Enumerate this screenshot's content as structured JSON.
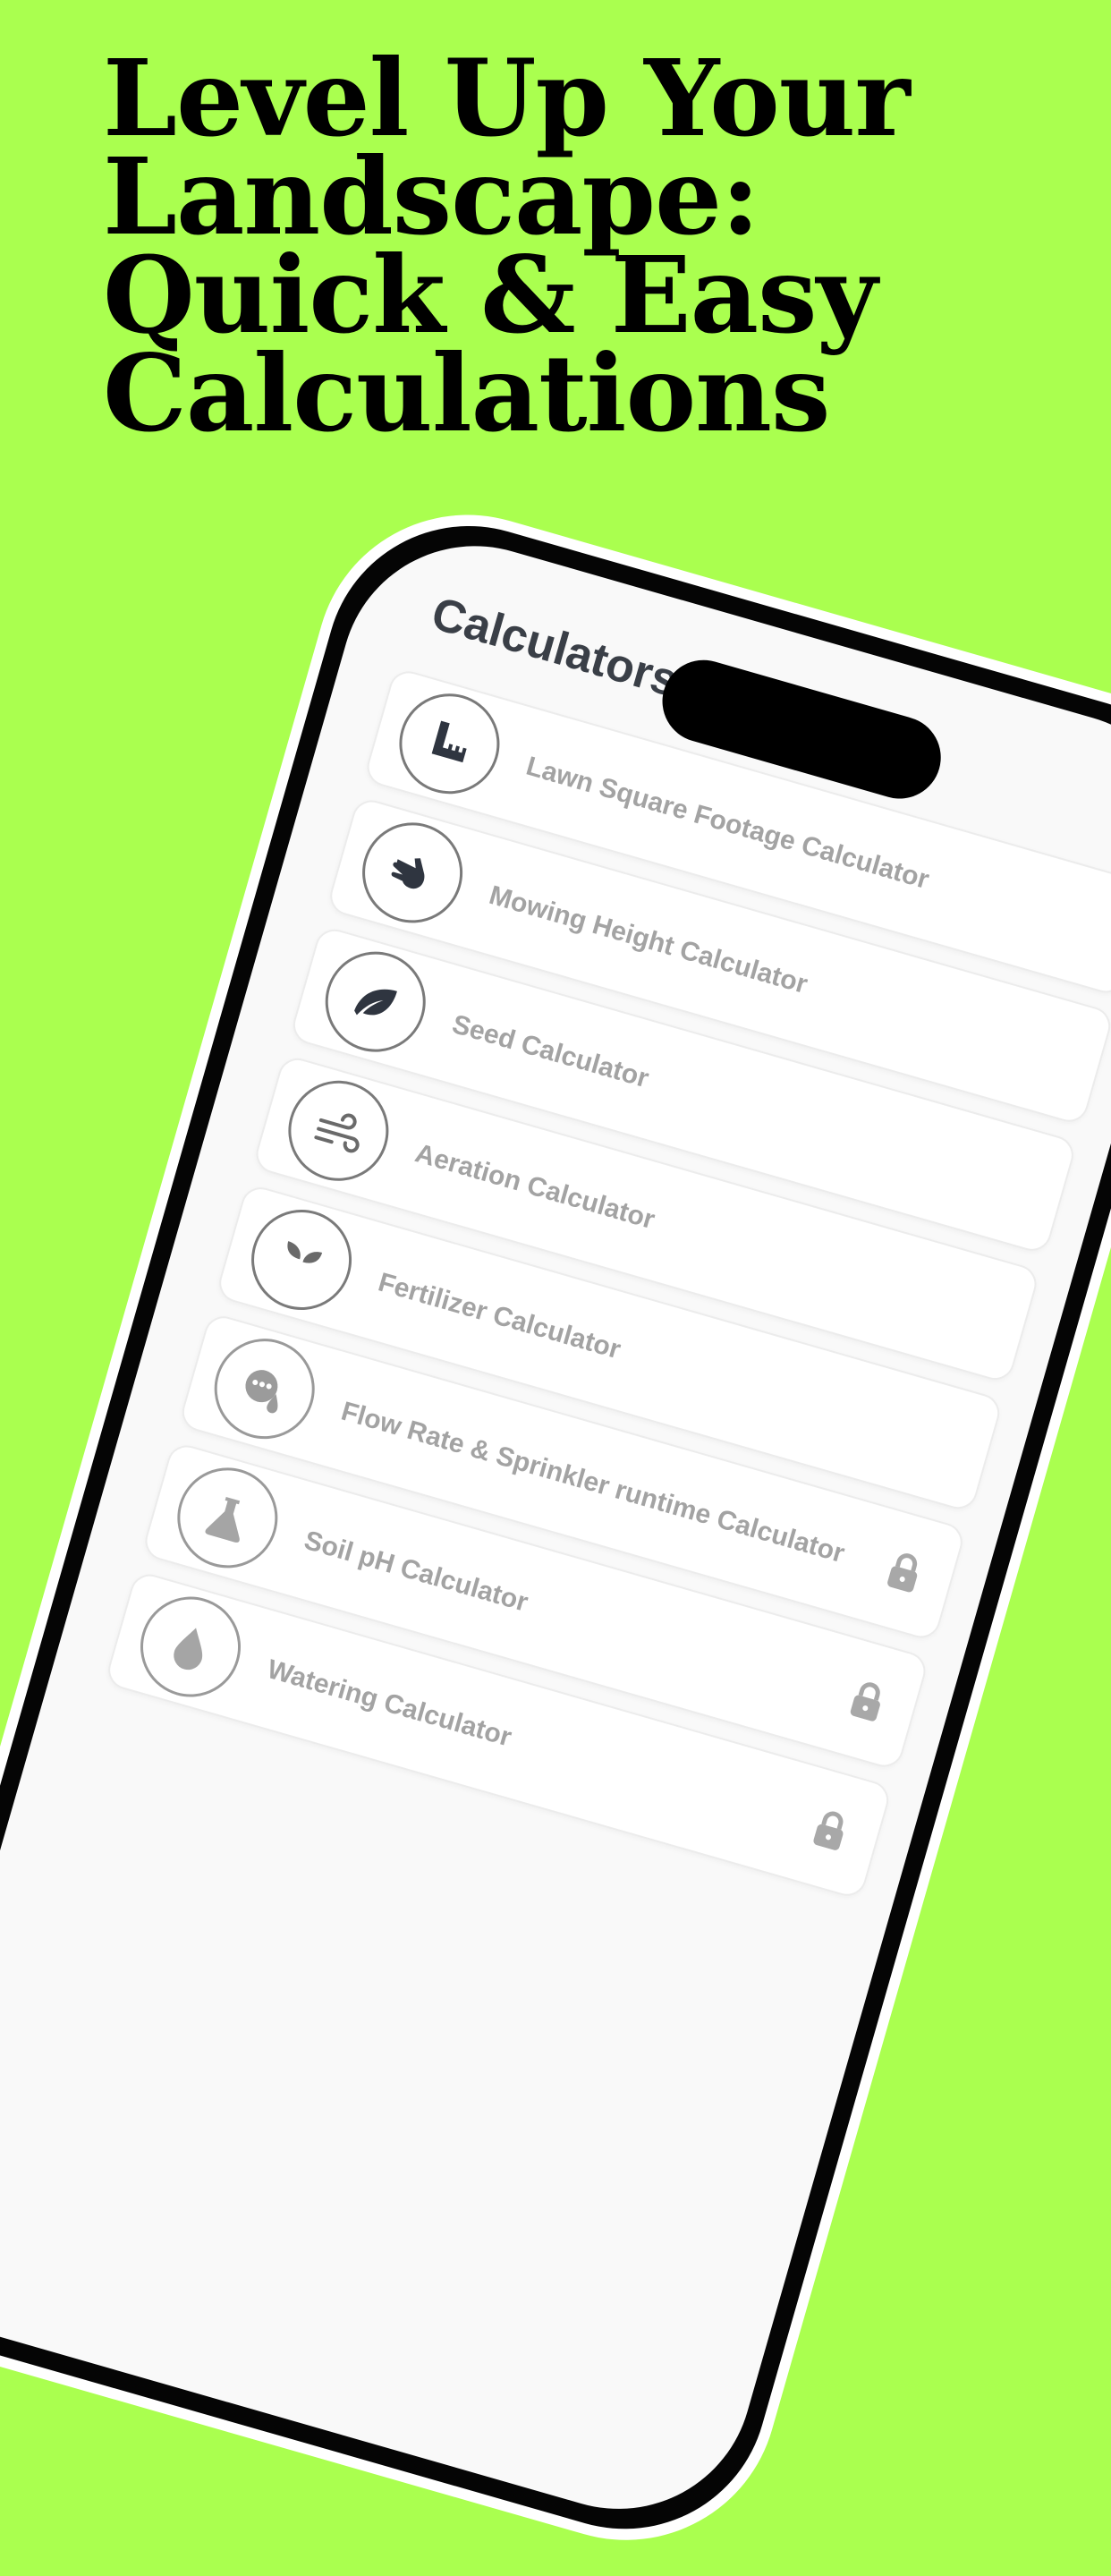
{
  "headline": {
    "line1": "Level Up Your",
    "line2": "Landscape:",
    "line3": "Quick & Easy",
    "line4": "Calculations"
  },
  "colors": {
    "background": "#aaff4f",
    "phone_frame": "#050505",
    "screen": "#f9f9f9",
    "title_text": "#3a3f47",
    "row_text": "#a3a3a3"
  },
  "screen": {
    "title": "Calculators",
    "items": [
      {
        "label": "Lawn Square Footage Calculator",
        "icon": "ruler-icon",
        "locked": false
      },
      {
        "label": "Mowing Height Calculator",
        "icon": "hand-scissors-icon",
        "locked": false
      },
      {
        "label": "Seed Calculator",
        "icon": "leaf-icon",
        "locked": false
      },
      {
        "label": "Aeration Calculator",
        "icon": "wind-icon",
        "locked": false
      },
      {
        "label": "Fertilizer Calculator",
        "icon": "seedling-icon",
        "locked": false
      },
      {
        "label": "Flow Rate & Sprinkler runtime Calculator",
        "icon": "water-gauge-icon",
        "locked": true
      },
      {
        "label": "Soil pH Calculator",
        "icon": "flask-icon",
        "locked": true
      },
      {
        "label": "Watering Calculator",
        "icon": "droplet-icon",
        "locked": true
      }
    ]
  }
}
